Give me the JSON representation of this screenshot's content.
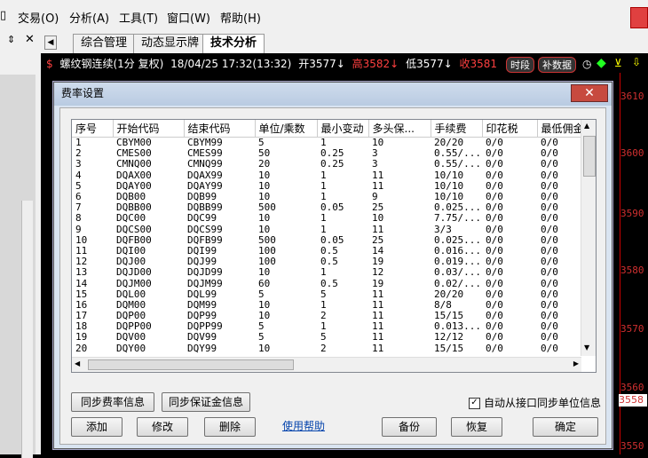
{
  "menu": {
    "items": [
      "交易(O)",
      "分析(A)",
      "工具(T)",
      "窗口(W)",
      "帮助(H)"
    ]
  },
  "tabs": [
    "综合管理",
    "动态显示牌",
    "技术分析"
  ],
  "chart": {
    "symbol": "螺纹钢连续(1分 复权)",
    "datetime": "18/04/25 17:32(13:32)",
    "open": "开3577↓",
    "high": "高3582↓",
    "low": "低3577↓",
    "close": "收3581",
    "btn_time": "时段",
    "btn_fill": "补数据",
    "axis_ticks": [
      "3610",
      "3600",
      "3590",
      "3580",
      "3570",
      "3560",
      "3550"
    ],
    "axis_current": "3558"
  },
  "dialog": {
    "title": "费率设置",
    "close_label": "✕",
    "columns": [
      "序号",
      "开始代码",
      "结束代码",
      "单位/乘数",
      "最小变动",
      "多头保...",
      "手续费",
      "印花税",
      "最低佣金"
    ],
    "rows": [
      [
        "1",
        "CBYM00",
        "CBYM99",
        "5",
        "1",
        "10",
        "20/20",
        "0/0",
        "0/0"
      ],
      [
        "2",
        "CMES00",
        "CMES99",
        "50",
        "0.25",
        "3",
        "0.55/...",
        "0/0",
        "0/0"
      ],
      [
        "3",
        "CMNQ00",
        "CMNQ99",
        "20",
        "0.25",
        "3",
        "0.55/...",
        "0/0",
        "0/0"
      ],
      [
        "4",
        "DQAX00",
        "DQAX99",
        "10",
        "1",
        "11",
        "10/10",
        "0/0",
        "0/0"
      ],
      [
        "5",
        "DQAY00",
        "DQAY99",
        "10",
        "1",
        "11",
        "10/10",
        "0/0",
        "0/0"
      ],
      [
        "6",
        "DQB00",
        "DQB99",
        "10",
        "1",
        "9",
        "10/10",
        "0/0",
        "0/0"
      ],
      [
        "7",
        "DQBB00",
        "DQBB99",
        "500",
        "0.05",
        "25",
        "0.025...",
        "0/0",
        "0/0"
      ],
      [
        "8",
        "DQC00",
        "DQC99",
        "10",
        "1",
        "10",
        "7.75/...",
        "0/0",
        "0/0"
      ],
      [
        "9",
        "DQCS00",
        "DQCS99",
        "10",
        "1",
        "11",
        "3/3",
        "0/0",
        "0/0"
      ],
      [
        "10",
        "DQFB00",
        "DQFB99",
        "500",
        "0.05",
        "25",
        "0.025...",
        "0/0",
        "0/0"
      ],
      [
        "11",
        "DQI00",
        "DQI99",
        "100",
        "0.5",
        "14",
        "0.016...",
        "0/0",
        "0/0"
      ],
      [
        "12",
        "DQJ00",
        "DQJ99",
        "100",
        "0.5",
        "19",
        "0.019...",
        "0/0",
        "0/0"
      ],
      [
        "13",
        "DQJD00",
        "DQJD99",
        "10",
        "1",
        "12",
        "0.03/...",
        "0/0",
        "0/0"
      ],
      [
        "14",
        "DQJM00",
        "DQJM99",
        "60",
        "0.5",
        "19",
        "0.02/...",
        "0/0",
        "0/0"
      ],
      [
        "15",
        "DQL00",
        "DQL99",
        "5",
        "5",
        "11",
        "20/20",
        "0/0",
        "0/0"
      ],
      [
        "16",
        "DQM00",
        "DQM99",
        "10",
        "1",
        "11",
        "8/8",
        "0/0",
        "0/0"
      ],
      [
        "17",
        "DQP00",
        "DQP99",
        "10",
        "2",
        "11",
        "15/15",
        "0/0",
        "0/0"
      ],
      [
        "18",
        "DQPP00",
        "DQPP99",
        "5",
        "1",
        "11",
        "0.013...",
        "0/0",
        "0/0"
      ],
      [
        "19",
        "DQV00",
        "DQV99",
        "5",
        "5",
        "11",
        "12/12",
        "0/0",
        "0/0"
      ],
      [
        "20",
        "DQY00",
        "DQY99",
        "10",
        "2",
        "11",
        "15/15",
        "0/0",
        "0/0"
      ]
    ],
    "sync_fee_label": "同步费率信息",
    "sync_margin_label": "同步保证金信息",
    "auto_sync_label": "自动从接口同步单位信息",
    "auto_sync_checked": "✓",
    "add_label": "添加",
    "edit_label": "修改",
    "delete_label": "删除",
    "help_label": "使用帮助",
    "backup_label": "备份",
    "restore_label": "恢复",
    "ok_label": "确定"
  }
}
